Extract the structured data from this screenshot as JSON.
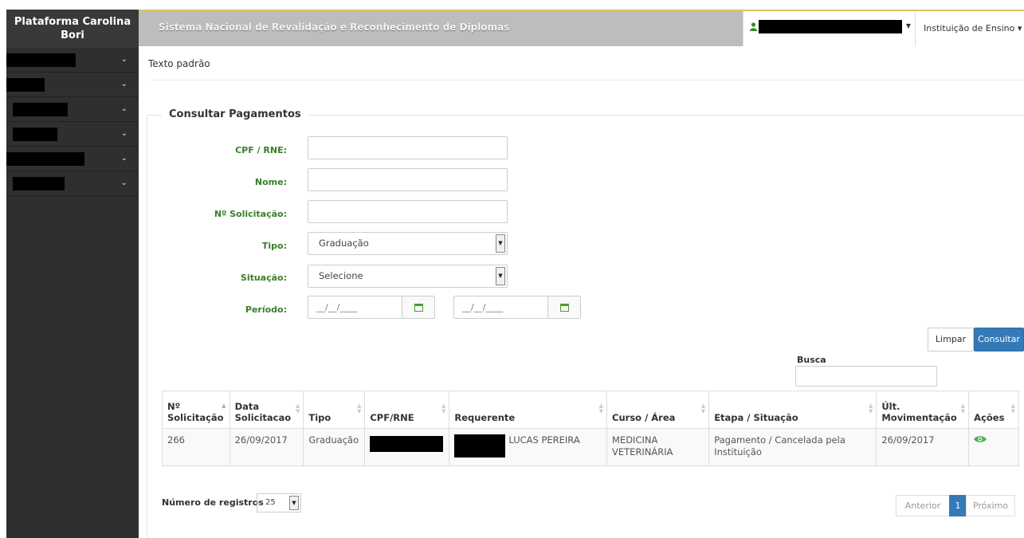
{
  "sidebar": {
    "brand": "Plataforma Carolina Bori",
    "items": [
      {
        "label": "",
        "caret": "⌄"
      },
      {
        "label": "",
        "caret": "⌄"
      },
      {
        "label": "",
        "caret": "⌄"
      },
      {
        "label": "",
        "caret": "⌄"
      },
      {
        "label": "",
        "caret": "⌄"
      },
      {
        "label": "",
        "caret": "⌄"
      }
    ]
  },
  "header": {
    "system_title": "Sistema Nacional de Revalidação e Reconhecimento de Diplomas",
    "user_icon": "user-icon",
    "institution_menu": "Instituição de Ensino ▾"
  },
  "breadcrumb": "Texto padrão",
  "form": {
    "legend": "Consultar Pagamentos",
    "cpf_label": "CPF / RNE:",
    "cpf_value": "",
    "nome_label": "Nome:",
    "nome_value": "",
    "solicitacao_label": "Nº Solicitação:",
    "solicitacao_value": "",
    "tipo_label": "Tipo:",
    "tipo_value": "Graduação",
    "situacao_label": "Situação:",
    "situacao_value": "Selecione",
    "periodo_label": "Período:",
    "periodo_start_placeholder": "__/__/____",
    "periodo_end_placeholder": "__/__/____",
    "calendar_icon": "calendar-icon"
  },
  "actions": {
    "clear_label": "Limpar",
    "search_label": "Consultar"
  },
  "busca": {
    "label": "Busca",
    "value": ""
  },
  "table": {
    "headers": [
      "Nº Solicitação",
      "Data Solicitacao",
      "Tipo",
      "CPF/RNE",
      "Requerente",
      "Curso / Área",
      "Etapa / Situação",
      "Últ. Movimentação",
      "Ações"
    ],
    "rows": [
      {
        "solicitacao": "266",
        "data": "26/09/2017",
        "tipo": "Graduação",
        "cpf": "",
        "requerente": "LUCAS PEREIRA",
        "curso": "MEDICINA VETERINÁRIA",
        "etapa": "Pagamento / Cancelada pela Instituição",
        "ult_mov": "26/09/2017",
        "acao_icon": "eye-icon"
      }
    ]
  },
  "footer": {
    "registros_label": "Número de registros",
    "registros_value": "25",
    "prev_label": "Anterior",
    "page_label": "1",
    "next_label": "Próximo"
  },
  "colors": {
    "label_green": "#3a7d2a",
    "primary_blue": "#337ab7",
    "sidebar_bg": "#2f2f2f",
    "header_bg": "#bdbdbd"
  }
}
